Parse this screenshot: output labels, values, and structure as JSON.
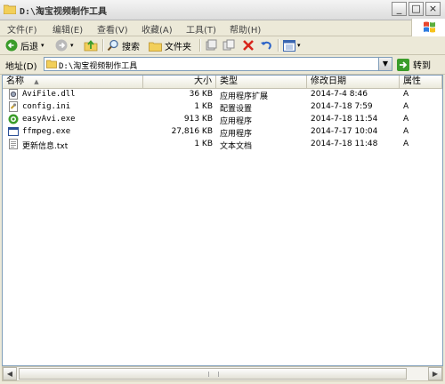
{
  "window": {
    "title": "D:\\淘宝视频制作工具",
    "min_label": "_",
    "max_label": "□",
    "close_label": "×"
  },
  "menu": [
    {
      "label": "文件(F)"
    },
    {
      "label": "编辑(E)"
    },
    {
      "label": "查看(V)"
    },
    {
      "label": "收藏(A)"
    },
    {
      "label": "工具(T)"
    },
    {
      "label": "帮助(H)"
    }
  ],
  "toolbar": {
    "back_label": "后退",
    "search_label": "搜索",
    "folders_label": "文件夹"
  },
  "address": {
    "label": "地址(D)",
    "value": "D:\\淘宝视频制作工具",
    "go_label": "转到"
  },
  "columns": {
    "name": "名称",
    "size": "大小",
    "type": "类型",
    "modified": "修改日期",
    "attr": "属性"
  },
  "files": [
    {
      "name": "AviFile.dll",
      "size": "36 KB",
      "type": "应用程序扩展",
      "modified": "2014-7-4 8:46",
      "attr": "A",
      "icon": "dll-icon"
    },
    {
      "name": "config.ini",
      "size": "1 KB",
      "type": "配置设置",
      "modified": "2014-7-18 7:59",
      "attr": "A",
      "icon": "ini-icon"
    },
    {
      "name": "easyAvi.exe",
      "size": "913 KB",
      "type": "应用程序",
      "modified": "2014-7-18 11:54",
      "attr": "A",
      "icon": "app-icon"
    },
    {
      "name": "ffmpeg.exe",
      "size": "27,816 KB",
      "type": "应用程序",
      "modified": "2014-7-17 10:04",
      "attr": "A",
      "icon": "exe-icon"
    },
    {
      "name": "更新信息.txt",
      "size": "1 KB",
      "type": "文本文档",
      "modified": "2014-7-18 11:48",
      "attr": "A",
      "icon": "txt-icon"
    }
  ],
  "colors": {
    "accent_green": "#3a9c2a",
    "address_border": "#7f9db9",
    "window_bg": "#ece9d8"
  }
}
